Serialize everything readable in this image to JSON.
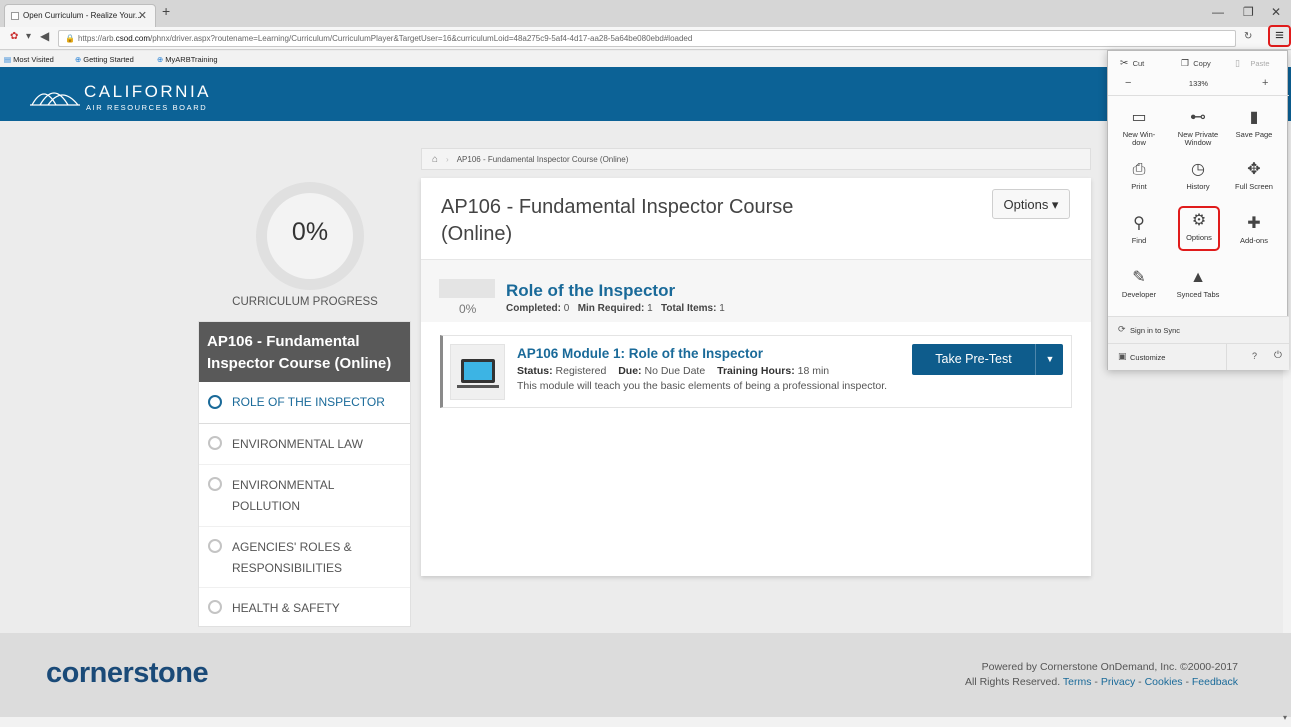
{
  "browser": {
    "tab_title": "Open Curriculum - Realize Your...",
    "tab_close": "✕",
    "new_tab": "+",
    "window_minimize": "—",
    "window_restore": "❐",
    "window_close": "✕",
    "url_prefix": "https://arb.",
    "url_domain": "csod.com",
    "url_rest": "/phnx/driver.aspx?routename=Learning/Curriculum/CurriculumPlayer&TargetUser=16&curriculumLoid=48a275c9-5af4-4d17-aa28-5a64be080ebd#loaded",
    "reload_icon": "↻",
    "menu_icon": "≡",
    "bookmarks": [
      "Most Visited",
      "Getting Started",
      "MyARBTraining"
    ]
  },
  "banner": {
    "title": "CALIFORNIA",
    "subtitle": "AIR RESOURCES BOARD",
    "color": "#0c6296"
  },
  "progress": {
    "percent": "0%",
    "label": "CURRICULUM PROGRESS"
  },
  "curriculum_nav": {
    "heading": "AP106 - Fundamental Inspector Course (Online)",
    "items": [
      {
        "label": "ROLE OF THE INSPECTOR",
        "active": true
      },
      {
        "label": "ENVIRONMENTAL LAW"
      },
      {
        "label": "ENVIRONMENTAL POLLUTION"
      },
      {
        "label": "AGENCIES' ROLES & RESPONSIBILITIES"
      },
      {
        "label": "HEALTH & SAFETY"
      }
    ]
  },
  "breadcrumb": {
    "home_icon": "home-icon",
    "current": "AP106 - Fundamental Inspector Course (Online)"
  },
  "course": {
    "title": "AP106 - Fundamental Inspector Course (Online)",
    "options_label": "Options ▾",
    "section": {
      "percent": "0%",
      "title": "Role of the Inspector",
      "completed_label": "Completed:",
      "completed_value": "0",
      "min_required_label": "Min Required:",
      "min_required_value": "1",
      "total_items_label": "Total Items:",
      "total_items_value": "1"
    },
    "module": {
      "title": "AP106 Module 1: Role of the Inspector",
      "status_label": "Status:",
      "status_value": "Registered",
      "due_label": "Due:",
      "due_value": "No Due Date",
      "hours_label": "Training Hours:",
      "hours_value": "18 min",
      "description": "This module will teach you the basic elements of being a professional inspector.",
      "action_label": "Take Pre-Test",
      "action_caret": "▼"
    }
  },
  "footer": {
    "logo": "cornerstone",
    "powered": "Powered by Cornerstone OnDemand, Inc. ©2000-2017",
    "rights": "All Rights Reserved.",
    "links": [
      "Terms",
      "Privacy",
      "Cookies",
      "Feedback"
    ]
  },
  "firefox_menu": {
    "cut": "Cut",
    "copy": "Copy",
    "paste": "Paste",
    "zoom_out": "−",
    "zoom_level": "133%",
    "zoom_in": "+",
    "items": [
      {
        "label": "New Win-\ndow",
        "icon": "window-icon"
      },
      {
        "label": "New Private\nWindow",
        "icon": "mask-icon"
      },
      {
        "label": "Save Page",
        "icon": "page-icon"
      },
      {
        "label": "Print",
        "icon": "printer-icon"
      },
      {
        "label": "History",
        "icon": "clock-icon"
      },
      {
        "label": "Full Screen",
        "icon": "fullscreen-icon"
      },
      {
        "label": "Find",
        "icon": "search-icon"
      },
      {
        "label": "Options",
        "icon": "gear-icon"
      },
      {
        "label": "Add-ons",
        "icon": "puzzle-icon"
      },
      {
        "label": "Developer",
        "icon": "wrench-icon"
      },
      {
        "label": "Synced Tabs",
        "icon": "synced-tabs-icon"
      }
    ],
    "sign_in": "Sign in to Sync",
    "customize": "Customize",
    "help_icon": "help-icon",
    "quit_icon": "power-icon",
    "highlight_color": "#e01b1b"
  }
}
